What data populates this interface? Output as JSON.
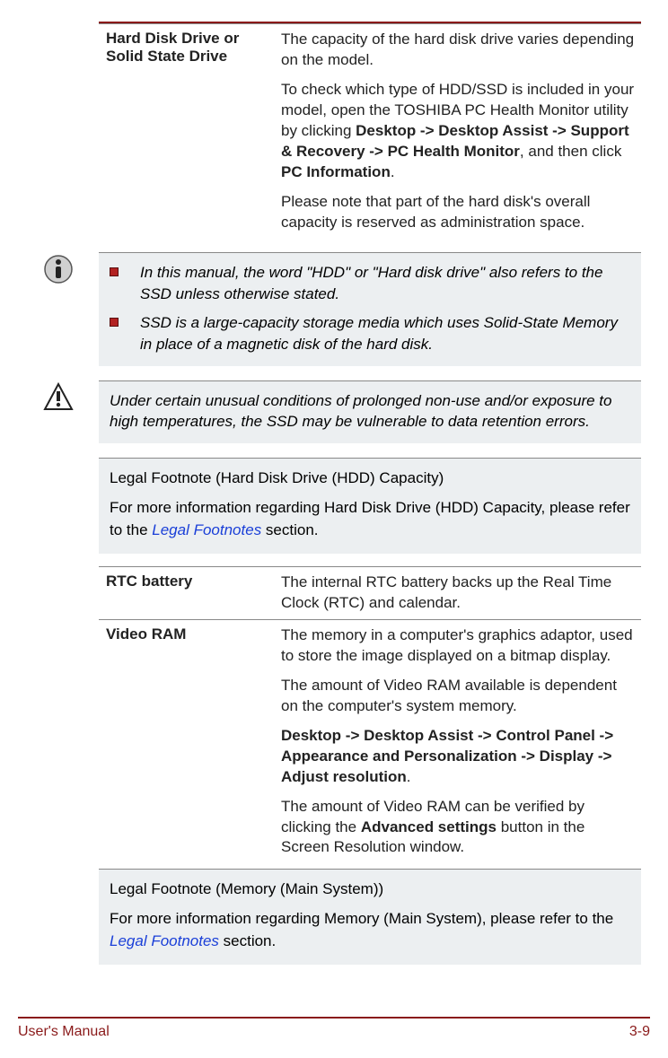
{
  "table1": {
    "row1": {
      "label": "Hard Disk Drive or Solid State Drive",
      "p1": "The capacity of the hard disk drive varies depending on the model.",
      "p2_a": "To check which type of HDD/SSD is included in your model, open the TOSHIBA PC Health Monitor utility by clicking ",
      "p2_b": "Desktop -> Desktop Assist -> Support & Recovery -> PC Health Monitor",
      "p2_c": ", and then click ",
      "p2_d": "PC Information",
      "p2_e": ".",
      "p3": "Please note that part of the hard disk's overall capacity is reserved as administration space."
    }
  },
  "info_box": {
    "bullet1": "In this manual, the word \"HDD\" or \"Hard disk drive\" also refers to the SSD unless otherwise stated.",
    "bullet2": "SSD is a large-capacity storage media which uses Solid-State Memory in place of a magnetic disk of the hard disk."
  },
  "warn_box": {
    "text": "Under certain unusual conditions of prolonged non-use and/or exposure to high temperatures, the SSD may be vulnerable to data retention errors."
  },
  "legal1": {
    "title": "Legal Footnote (Hard Disk Drive (HDD) Capacity)",
    "p_a": "For more information regarding Hard Disk Drive (HDD) Capacity, please refer to the ",
    "link": "Legal Footnotes",
    "p_b": " section."
  },
  "table2": {
    "row1": {
      "label": "RTC battery",
      "p1": "The internal RTC battery backs up the Real Time Clock (RTC) and calendar."
    },
    "row2": {
      "label": "Video RAM",
      "p1": "The memory in a computer's graphics adaptor, used to store the image displayed on a bitmap display.",
      "p2": "The amount of Video RAM available is dependent on the computer's system memory.",
      "p3_a": "Desktop -> Desktop Assist -> Control Panel -> Appearance and Personalization -> Display -> Adjust resolution",
      "p3_b": ".",
      "p4_a": "The amount of Video RAM can be verified by clicking the ",
      "p4_b": "Advanced settings",
      "p4_c": " button in the Screen Resolution window."
    }
  },
  "legal2": {
    "title": "Legal Footnote (Memory (Main System))",
    "p_a": "For more information regarding Memory (Main System), please refer to the ",
    "link": "Legal Footnotes",
    "p_b": " section."
  },
  "footer": {
    "left": "User's Manual",
    "right": "3-9"
  }
}
